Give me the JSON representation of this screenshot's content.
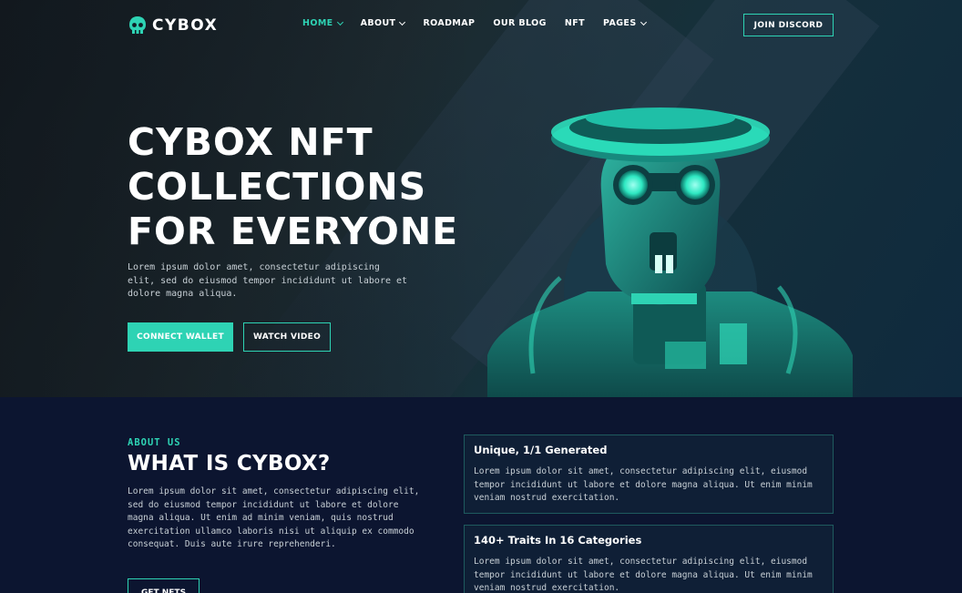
{
  "brand": {
    "name": "CYBOX",
    "accent": "#2ed3b4",
    "background": "#0c1530"
  },
  "nav": {
    "items": [
      {
        "label": "HOME",
        "dropdown": true,
        "active": true
      },
      {
        "label": "ABOUT",
        "dropdown": true,
        "active": false
      },
      {
        "label": "ROADMAP",
        "dropdown": false,
        "active": false
      },
      {
        "label": "OUR BLOG",
        "dropdown": false,
        "active": false
      },
      {
        "label": "NFT",
        "dropdown": false,
        "active": false
      },
      {
        "label": "PAGES",
        "dropdown": true,
        "active": false
      }
    ],
    "cta": "JOIN DISCORD"
  },
  "hero": {
    "title_lines": [
      "CYBOX NFT",
      "COLLECTIONS",
      "FOR EVERYONE"
    ],
    "description": "Lorem ipsum dolor amet, consectetur adipiscing elit, sed do eiusmod tempor incididunt ut labore et dolore magna aliqua.",
    "primary_button": "CONNECT WALLET",
    "secondary_button": "WATCH VIDEO",
    "image": "robot-nft-illustration"
  },
  "about": {
    "label": "ABOUT US",
    "title": "WHAT IS CYBOX?",
    "description": "Lorem ipsum dolor sit amet, consectetur adipiscing elit, sed do eiusmod tempor incididunt ut labore et dolore magna aliqua. Ut enim ad minim veniam, quis nostrud exercitation ullamco laboris nisi ut aliquip ex commodo consequat. Duis aute irure reprehenderi.",
    "button": "GET NFTS",
    "cards": [
      {
        "title": "Unique, 1/1 Generated",
        "description": "Lorem ipsum dolor sit amet, consectetur adipiscing elit, eiusmod tempor incididunt ut labore et dolore magna aliqua. Ut enim minim veniam nostrud exercitation."
      },
      {
        "title": "140+ Traits In 16 Categories",
        "description": "Lorem ipsum dolor sit amet, consectetur adipiscing elit, eiusmod tempor incididunt ut labore et dolore magna aliqua. Ut enim minim veniam nostrud exercitation."
      }
    ]
  }
}
